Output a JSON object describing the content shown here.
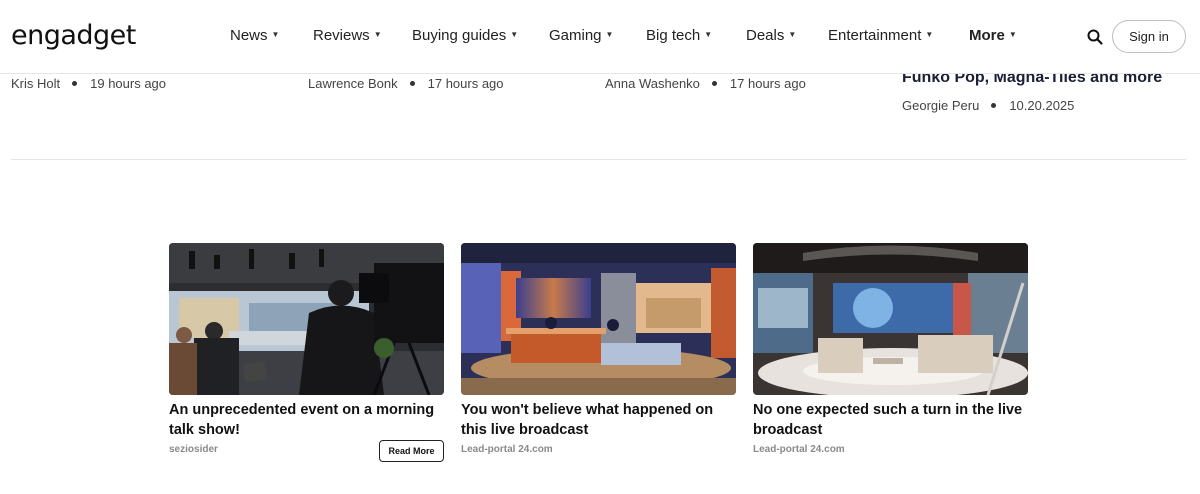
{
  "header": {
    "logo": "engadget",
    "nav": [
      {
        "label": "News",
        "caret": "▼"
      },
      {
        "label": "Reviews",
        "caret": "▼"
      },
      {
        "label": "Buying guides",
        "caret": "▼"
      },
      {
        "label": "Gaming",
        "caret": "▼"
      },
      {
        "label": "Big tech",
        "caret": "▼"
      },
      {
        "label": "Deals",
        "caret": "▼"
      },
      {
        "label": "Entertainment",
        "caret": "▼"
      },
      {
        "label": "More",
        "caret": "▼"
      }
    ],
    "signin_label": "Sign in"
  },
  "stories": [
    {
      "author": "Kris Holt",
      "time": "19 hours ago"
    },
    {
      "author": "Lawrence Bonk",
      "time": "17 hours ago"
    },
    {
      "author": "Anna Washenko",
      "time": "17 hours ago"
    },
    {
      "title_fragment": "Funko Pop, Magna-Tiles and more",
      "author": "Georgie Peru",
      "time": "10.20.2025"
    }
  ],
  "sponsored": [
    {
      "headline": "An unprecedented event on a morning talk show!",
      "source": "seziosider",
      "cta": "Read More"
    },
    {
      "headline": "You won't believe what happened on this live broadcast",
      "source": "Lead-portal 24.com"
    },
    {
      "headline": "No one expected such a turn in the live broadcast",
      "source": "Lead-portal 24.com"
    }
  ]
}
